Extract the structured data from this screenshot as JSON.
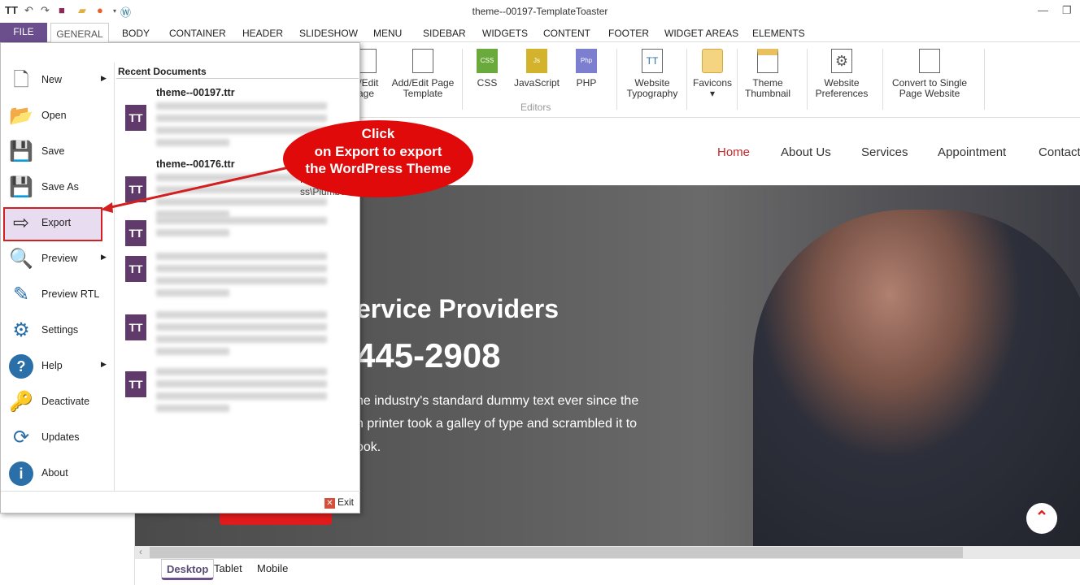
{
  "window": {
    "title": "theme--00197-TemplateToaster",
    "min": "—",
    "max": "❐"
  },
  "tabs": [
    "FILE",
    "GENERAL",
    "BODY",
    "CONTAINER",
    "HEADER",
    "SLIDESHOW",
    "MENU",
    "SIDEBAR",
    "WIDGETS",
    "CONTENT",
    "FOOTER",
    "WIDGET AREAS",
    "ELEMENTS"
  ],
  "ribbon": {
    "items": [
      "d/Edit\nage",
      "Add/Edit Page\nTemplate",
      "CSS",
      "JavaScript",
      "PHP",
      "Website\nTypography",
      "Favicons\n▾",
      "Theme\nThumbnail",
      "Website\nPreferences",
      "Convert to Single\nPage Website"
    ],
    "group": "Editors",
    "badges": {
      "css": "CSS",
      "js": "Js",
      "php": "Php"
    }
  },
  "menu": {
    "items": [
      {
        "label": "New",
        "icon": "document-icon",
        "sub": true
      },
      {
        "label": "Open",
        "icon": "folder-icon"
      },
      {
        "label": "Save",
        "icon": "save-icon"
      },
      {
        "label": "Save As",
        "icon": "save-as-icon"
      },
      {
        "label": "Export",
        "icon": "export-icon"
      },
      {
        "label": "Preview",
        "icon": "magnifier-icon",
        "sub": true
      },
      {
        "label": "Preview RTL",
        "icon": "pen-icon"
      },
      {
        "label": "Settings",
        "icon": "gear-icon"
      },
      {
        "label": "Help",
        "icon": "help-icon",
        "sub": true
      },
      {
        "label": "Deactivate",
        "icon": "key-icon"
      },
      {
        "label": "Updates",
        "icon": "refresh-icon"
      },
      {
        "label": "About",
        "icon": "info-icon"
      }
    ],
    "recent_title": "Recent Documents",
    "recent": [
      {
        "name": "theme--00197.ttr"
      },
      {
        "name": "theme--00176.ttr",
        "partial": "Ma\nss\\Plumbe"
      },
      {
        "name": ""
      },
      {
        "name": ""
      },
      {
        "name": ""
      },
      {
        "name": ""
      }
    ],
    "exit": "Exit"
  },
  "callout": {
    "lines": [
      "Click",
      "on Export to export",
      "the WordPress Theme"
    ],
    "color": "#e00a0a"
  },
  "site": {
    "nav": [
      "Home",
      "About Us",
      "Services",
      "Appointment",
      "Contact"
    ],
    "active_color": "#c0282d",
    "hero_title": "ervice Providers",
    "hero_phone": "445-2908",
    "hero_text": [
      "he industry's standard dummy text ever since the",
      "n printer took a galley of type and scrambled it to",
      "ook."
    ]
  },
  "devices": [
    "Desktop",
    "Tablet",
    "Mobile"
  ]
}
